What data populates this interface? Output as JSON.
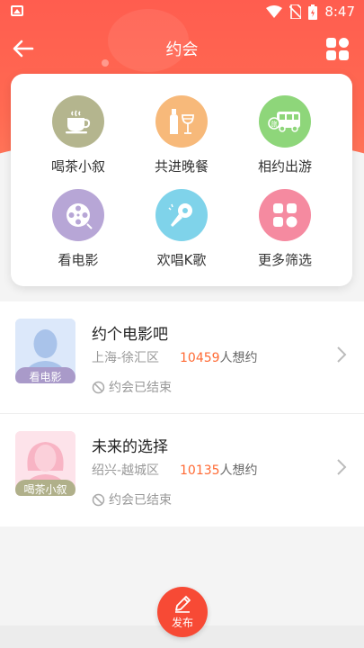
{
  "status_bar": {
    "time": "8:47"
  },
  "header": {
    "title": "约会"
  },
  "categories": [
    {
      "label": "喝茶小叙",
      "icon": "tea-cup-icon",
      "color": "#b4b58e"
    },
    {
      "label": "共进晚餐",
      "icon": "wine-icon",
      "color": "#f7b97a"
    },
    {
      "label": "相约出游",
      "icon": "tour-bus-icon",
      "color": "#8ed67a"
    },
    {
      "label": "看电影",
      "icon": "film-reel-icon",
      "color": "#b7a6d6"
    },
    {
      "label": "欢唱K歌",
      "icon": "microphone-icon",
      "color": "#7fd3ea"
    },
    {
      "label": "更多筛选",
      "icon": "grid-icon",
      "color": "#f58aa0"
    }
  ],
  "dates": [
    {
      "title": "约个电影吧",
      "location": "上海-徐汇区",
      "count": "10459",
      "count_suffix": "人想约",
      "status": "约会已结束",
      "tag": "看电影",
      "tag_color": "#a99ac9",
      "avatar": "male-avatar-icon"
    },
    {
      "title": "未来的选择",
      "location": "绍兴-越城区",
      "count": "10135",
      "count_suffix": "人想约",
      "status": "约会已结束",
      "tag": "喝茶小叙",
      "tag_color": "#b0b08a",
      "avatar": "female-avatar-icon"
    }
  ],
  "publish": {
    "label": "发布"
  },
  "colors": {
    "accent": "#ff5d4f",
    "count": "#ff6a34"
  }
}
